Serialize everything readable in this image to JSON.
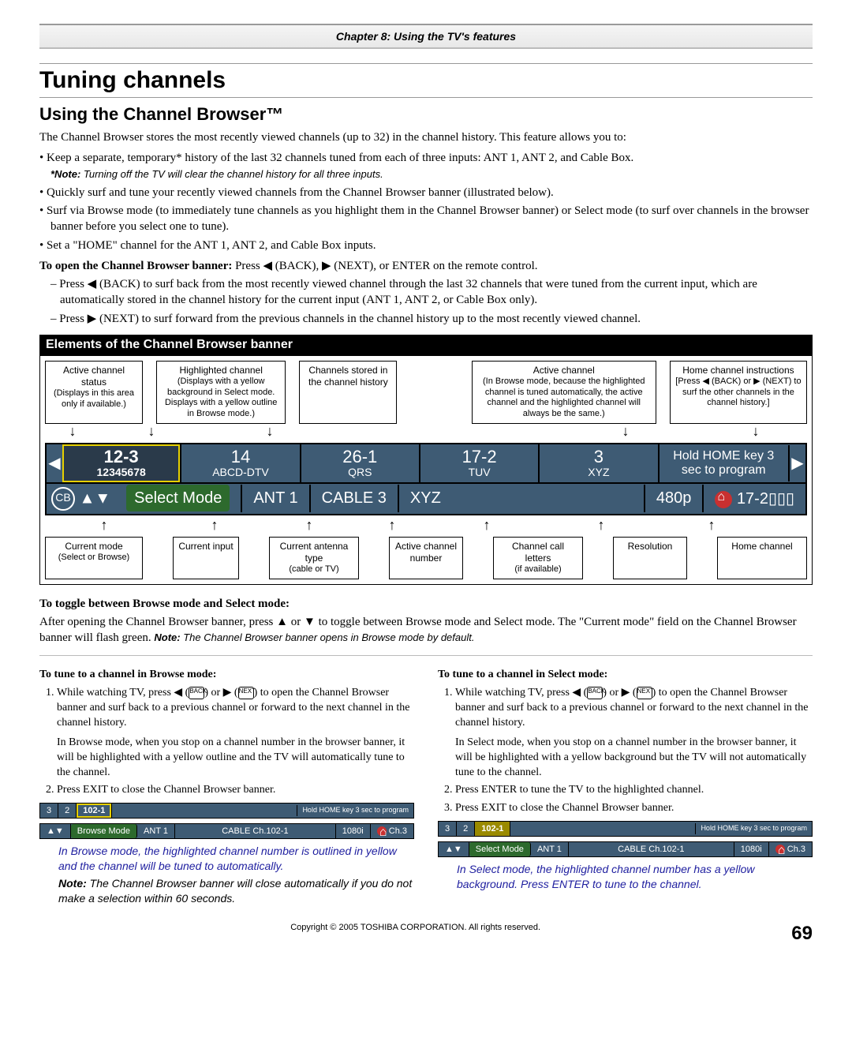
{
  "chapter": "Chapter 8: Using the TV's features",
  "h1": "Tuning channels",
  "h2": "Using the Channel Browser™",
  "intro": "The Channel Browser stores the most recently viewed channels (up to 32) in the channel history. This feature allows you to:",
  "bullets": {
    "b1": "Keep a separate, temporary* history of the last 32 channels tuned from each of three inputs: ANT 1, ANT 2, and Cable Box.",
    "b1note_label": "*Note:",
    "b1note": " Turning off the TV will clear the channel history for all three inputs.",
    "b2": "Quickly surf and tune your recently viewed channels from the Channel Browser banner (illustrated below).",
    "b3": "Surf via Browse mode (to immediately tune channels as you highlight them in the Channel Browser banner) or Select mode (to surf over channels in the browser banner before you select one to tune).",
    "b4": "Set a \"HOME\" channel for the ANT 1, ANT 2, and Cable Box inputs."
  },
  "open_banner_lead": "To open the Channel Browser banner:",
  "open_banner": " Press ◀ (BACK), ▶ (NEXT), or ENTER on the remote control.",
  "open_sub1": "– Press ◀ (BACK) to surf back from the most recently viewed channel through the last 32 channels that were tuned from the current input, which are automatically stored in the channel history for the current input (ANT 1, ANT 2, or Cable Box only).",
  "open_sub2": "– Press ▶ (NEXT) to surf forward from the previous channels in the channel history up to the most recently viewed channel.",
  "elements_hdr": "Elements of the Channel Browser banner",
  "labels": {
    "active_status_t": "Active channel status",
    "active_status_s": "(Displays in this area only if available.)",
    "highlighted_t": "Highlighted channel",
    "highlighted_s": "(Displays with a yellow background in Select mode. Displays with a yellow outline in Browse mode.)",
    "stored_t": "Channels stored in the channel history",
    "active_ch_t": "Active channel",
    "active_ch_s": "(In Browse mode, because the highlighted channel is tuned automatically, the active channel and the highlighted channel will always be the same.)",
    "home_instr_t": "Home channel instructions",
    "home_instr_s": "[Press ◀ (BACK) or ▶ (NEXT) to surf the other channels in the channel history.]",
    "cur_mode_t": "Current mode",
    "cur_mode_s": "(Select or Browse)",
    "cur_input": "Current input",
    "cur_ant_t": "Current antenna type",
    "cur_ant_s": "(cable or TV)",
    "act_num": "Active channel number",
    "call_t": "Channel call letters",
    "call_s": "(if available)",
    "res": "Resolution",
    "home_ch": "Home channel"
  },
  "strip": {
    "c0_num": "12-3",
    "c0_name": "12345678",
    "c1_num": "14",
    "c1_name": "ABCD-DTV",
    "c2_num": "26-1",
    "c2_name": "QRS",
    "c3_num": "17-2",
    "c3_name": "TUV",
    "c4_num": "3",
    "c4_name": "XYZ",
    "hold": "Hold HOME key 3 sec to program",
    "mode": "Select Mode",
    "input": "ANT 1",
    "ant": "CABLE 3",
    "call": "XYZ",
    "res": "480p",
    "home": "17-2"
  },
  "toggle_hdr": "To toggle between Browse mode and Select mode:",
  "toggle_body": "After opening the Channel Browser banner, press ▲ or ▼ to toggle between Browse mode and Select mode.  The \"Current mode\" field on the Channel Browser banner will flash green.  ",
  "toggle_note_lbl": "Note:",
  "toggle_note": " The Channel Browser banner opens in Browse mode by default.",
  "browse": {
    "hdr": "To tune to a channel in Browse mode:",
    "s1a": "While watching TV, press ◀ (",
    "s1b": ") or ▶ (",
    "s1c": ")  to open the Channel Browser banner and surf back to a previous channel or forward to the next channel in the channel history.",
    "s1d": "In Browse mode, when you stop on a channel number in the browser banner, it will be highlighted with a yellow outline and the TV will automatically tune to the channel.",
    "s2": "Press EXIT to close the Channel Browser banner.",
    "cap1": "In Browse mode, the highlighted channel number is outlined in yellow and the channel will be tuned to automatically.",
    "note_lbl": "Note:",
    "note": " The Channel Browser banner will close automatically if you do not make a selection within 60 seconds."
  },
  "select": {
    "hdr": "To tune to a channel in Select mode:",
    "s1a": "While watching TV, press ◀ (",
    "s1b": ") or ▶ (",
    "s1c": ")  to open the Channel Browser banner and surf back to a previous channel or forward to the next channel in the channel history.",
    "s1d": "In Select mode, when you stop on a channel number in the browser banner, it will be highlighted with a yellow background but the TV will not automatically tune to the channel.",
    "s2": "Press ENTER to tune the TV to the highlighted channel.",
    "s3": "Press EXIT to close the Channel Browser banner.",
    "cap1": "In Select mode, the highlighted channel number has a yellow background. Press ENTER to tune to the channel."
  },
  "mini": {
    "a": "3",
    "b": "2",
    "c": "102-1",
    "mode_b": "Browse Mode",
    "mode_s": "Select Mode",
    "ant": "ANT 1",
    "src": "CABLE  Ch.102-1",
    "res": "1080i",
    "home": "Ch.3",
    "hold": "Hold HOME key 3 sec to program"
  },
  "footer": "Copyright © 2005 TOSHIBA CORPORATION. All rights reserved.",
  "page_no": "69"
}
